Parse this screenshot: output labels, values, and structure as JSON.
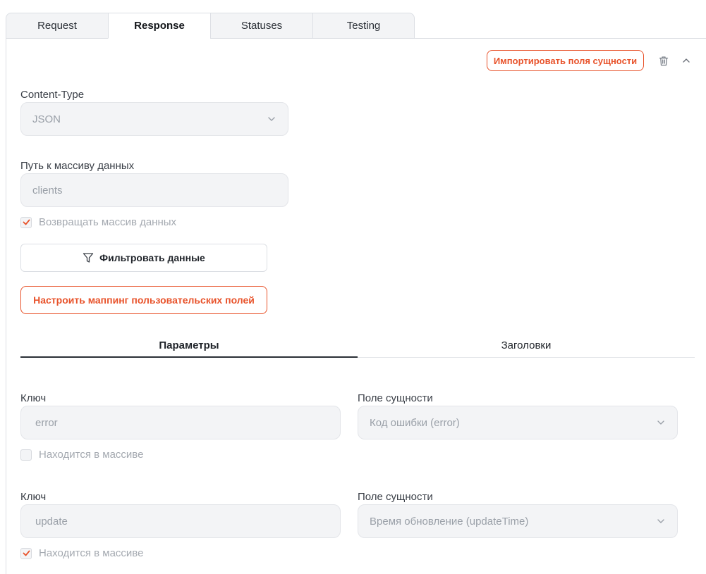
{
  "tabs": [
    {
      "label": "Request"
    },
    {
      "label": "Response"
    },
    {
      "label": "Statuses"
    },
    {
      "label": "Testing"
    }
  ],
  "toolbar": {
    "import_label": "Импортировать поля сущности",
    "trash_icon": "trash-icon",
    "collapse_icon": "chevron-up-icon"
  },
  "content_type": {
    "label": "Content-Type",
    "value": "JSON"
  },
  "data_path": {
    "label": "Путь к массиву данных",
    "value": "clients"
  },
  "return_array": {
    "label": "Возвращать массив данных",
    "checked": true
  },
  "filter_button": {
    "label": "Фильтровать данные",
    "icon": "filter-icon"
  },
  "mapping_button": {
    "label": "Настроить маппинг пользовательских полей"
  },
  "subtabs": [
    {
      "label": "Параметры"
    },
    {
      "label": "Заголовки"
    }
  ],
  "params": [
    {
      "key_label": "Ключ",
      "key_value": "error",
      "entity_label": "Поле сущности",
      "entity_value": "Код ошибки (error)",
      "in_array_label": "Находится в массиве",
      "in_array": false
    },
    {
      "key_label": "Ключ",
      "key_value": "update",
      "entity_label": "Поле сущности",
      "entity_value": "Время обновление (updateTime)",
      "in_array_label": "Находится в массиве",
      "in_array": true
    }
  ],
  "colors": {
    "accent": "#e8532b",
    "field_bg": "#f3f4f6",
    "border": "#dcdfe4"
  }
}
